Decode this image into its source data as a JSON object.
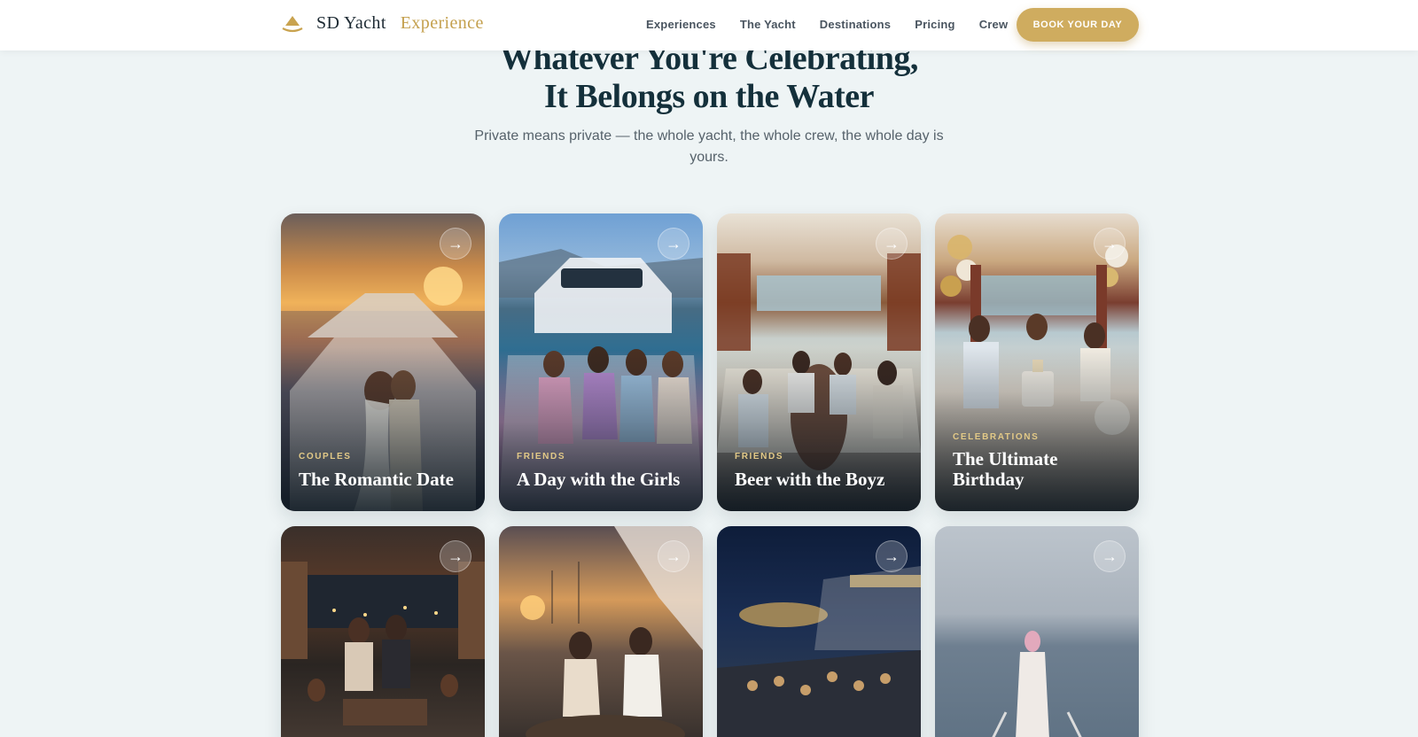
{
  "header": {
    "brand_primary": "SD Yacht",
    "brand_secondary": "Experience",
    "nav": [
      "Experiences",
      "The Yacht",
      "Destinations",
      "Pricing",
      "Crew"
    ],
    "cta_label": "BOOK YOUR DAY"
  },
  "hero": {
    "headline_line1": "Whatever You're Celebrating,",
    "headline_line2": "It Belongs on the Water",
    "subtitle": "Private means private — the whole yacht, the whole crew, the whole day is yours."
  },
  "cards": [
    {
      "category": "COUPLES",
      "title": "The Romantic Date"
    },
    {
      "category": "FRIENDS",
      "title": "A Day with the Girls"
    },
    {
      "category": "FRIENDS",
      "title": "Beer with the Boyz"
    },
    {
      "category": "CELEBRATIONS",
      "title": "The Ultimate Birthday"
    },
    {
      "category": "",
      "title": ""
    },
    {
      "category": "",
      "title": ""
    },
    {
      "category": "",
      "title": ""
    },
    {
      "category": "",
      "title": ""
    }
  ],
  "arrow_glyph": "→",
  "colors": {
    "accent_gold": "#cfac5f",
    "heading_navy": "#14303b",
    "page_bg": "#eef4f5",
    "category_gold": "#e2c987"
  }
}
